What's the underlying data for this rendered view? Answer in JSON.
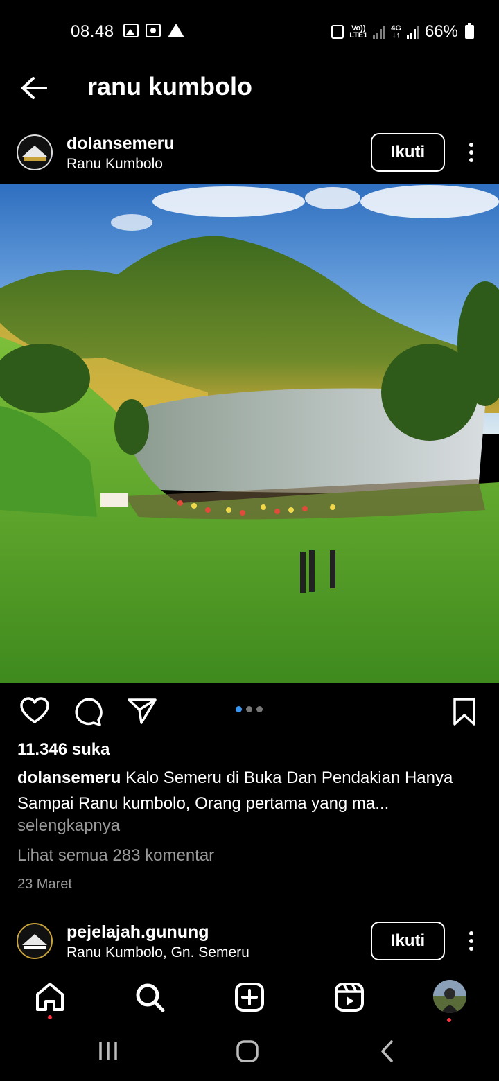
{
  "status_bar": {
    "time": "08.48",
    "battery": "66%",
    "network_1": "Vo)) LTE1",
    "network_2": "4G"
  },
  "header": {
    "title": "ranu kumbolo",
    "back_icon": "back-arrow-icon"
  },
  "post1": {
    "username": "dolansemeru",
    "location": "Ranu Kumbolo",
    "follow_label": "Ikuti",
    "likes": "11.346 suka",
    "caption_user": "dolansemeru",
    "caption_text": " Kalo Semeru di Buka Dan Pendakian Hanya Sampai Ranu kumbolo, Orang pertama yang ma...",
    "more_label": "selengkapnya",
    "comments_label": "Lihat semua 283 komentar",
    "date": "23 Maret",
    "carousel": {
      "count": 3,
      "active": 0
    }
  },
  "post2": {
    "username": "pejelajah.gunung",
    "location": "Ranu Kumbolo, Gn. Semeru",
    "follow_label": "Ikuti"
  },
  "bottom_nav": {
    "items": [
      "home-icon",
      "search-icon",
      "create-icon",
      "reels-icon",
      "profile-avatar"
    ]
  },
  "colors": {
    "background": "#000000",
    "text": "#ffffff",
    "muted": "#9a9a9a",
    "accent_blue": "#3897f0",
    "notification_red": "#ff3040"
  }
}
